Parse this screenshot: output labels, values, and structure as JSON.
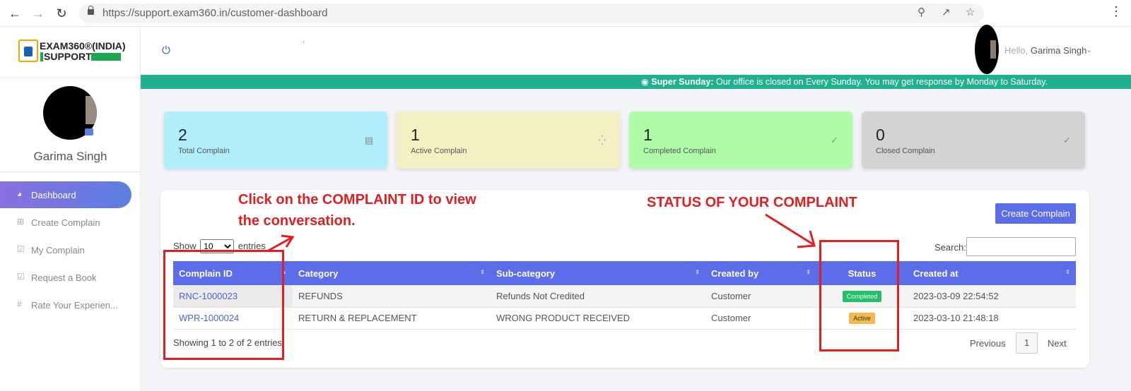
{
  "browser": {
    "url": "https://support.exam360.in/customer-dashboard"
  },
  "logo": {
    "line1": "EXAM360®(INDIA)",
    "line2": "SUPPORT"
  },
  "sidebar": {
    "user_name": "Garima Singh",
    "items": [
      {
        "label": "Dashboard",
        "icon": "pie-chart-icon",
        "active": true
      },
      {
        "label": "Create Complain",
        "icon": "plus-square-icon",
        "active": false
      },
      {
        "label": "My Complain",
        "icon": "check-square-icon",
        "active": false
      },
      {
        "label": "Request a Book",
        "icon": "check-square-icon",
        "active": false
      },
      {
        "label": "Rate Your Experien...",
        "icon": "hash-icon",
        "active": false
      }
    ]
  },
  "header": {
    "hello": "Hello,",
    "user_name": "Garima Singh",
    "dot": "."
  },
  "notice": {
    "bold": "Super Sunday:",
    "text": " Our office is closed on Every Sunday. You may get response by Monday to Saturday."
  },
  "stats": [
    {
      "value": "2",
      "label": "Total Complain",
      "color": "#b0eefc",
      "icon": "ticket-icon"
    },
    {
      "value": "1",
      "label": "Active Complain",
      "color": "#f5efc4",
      "icon": "spinner-icon"
    },
    {
      "value": "1",
      "label": "Completed Complain",
      "color": "#aefca8",
      "icon": "check-circle-icon"
    },
    {
      "value": "0",
      "label": "Closed Complain",
      "color": "#d3d3d3",
      "icon": "check-circle-icon"
    }
  ],
  "panel": {
    "create_button": "Create Complain",
    "show_label": "Show",
    "show_value": "10",
    "entries_label": "entries",
    "search_label": "Search:",
    "info": "Showing 1 to 2 of 2 entries",
    "pager": {
      "prev": "Previous",
      "current": "1",
      "next": "Next"
    }
  },
  "table": {
    "headers": [
      "Complain ID",
      "Category",
      "Sub-category",
      "Created by",
      "Status",
      "Created at"
    ],
    "rows": [
      {
        "id": "RNC-1000023",
        "category": "REFUNDS",
        "subcategory": "Refunds Not Credited",
        "created_by": "Customer",
        "status": "Completed",
        "created_at": "2023-03-09 22:54:52"
      },
      {
        "id": "WPR-1000024",
        "category": "RETURN & REPLACEMENT",
        "subcategory": "WRONG PRODUCT RECEIVED",
        "created_by": "Customer",
        "status": "Active",
        "created_at": "2023-03-10 21:48:18"
      }
    ]
  },
  "annotations": {
    "click_line1": "Click on the COMPLAINT ID to view",
    "click_line2": "the conversation.",
    "status_note": "STATUS OF YOUR COMPLAINT",
    "color": "#e02020"
  }
}
